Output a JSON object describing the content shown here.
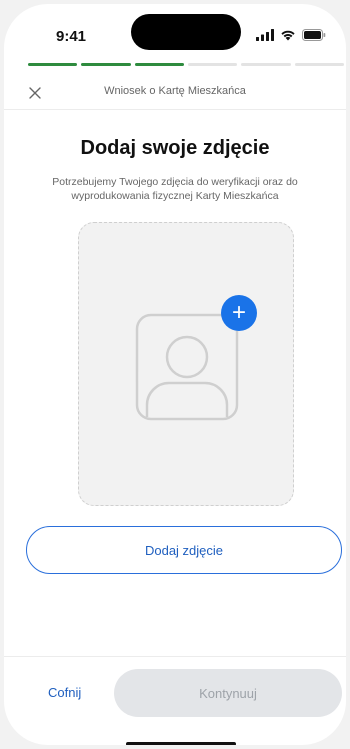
{
  "status_bar": {
    "time": "9:41",
    "icons": [
      "signal-icon",
      "wifi-icon",
      "battery-icon"
    ]
  },
  "progress": {
    "total_steps": 6,
    "completed_steps": 3,
    "active_color": "#2e8b3e",
    "inactive_color": "#e3e3e3"
  },
  "header": {
    "title": "Wniosek o Kartę Mieszkańca",
    "close_icon": "close-icon"
  },
  "main": {
    "title": "Dodaj swoje zdjęcie",
    "description": "Potrzebujemy Twojego zdjęcia do weryfikacji oraz do wyprodukowania fizycznej Karty Mieszkańca",
    "add_fab_symbol": "+",
    "add_photo_label": "Dodaj zdjęcie"
  },
  "footer": {
    "back_label": "Cofnij",
    "continue_label": "Kontynuuj"
  },
  "colors": {
    "primary": "#1a73e8",
    "link": "#1f5fbf",
    "disabled_bg": "#e3e5e8",
    "disabled_text": "#9ea3a9"
  }
}
